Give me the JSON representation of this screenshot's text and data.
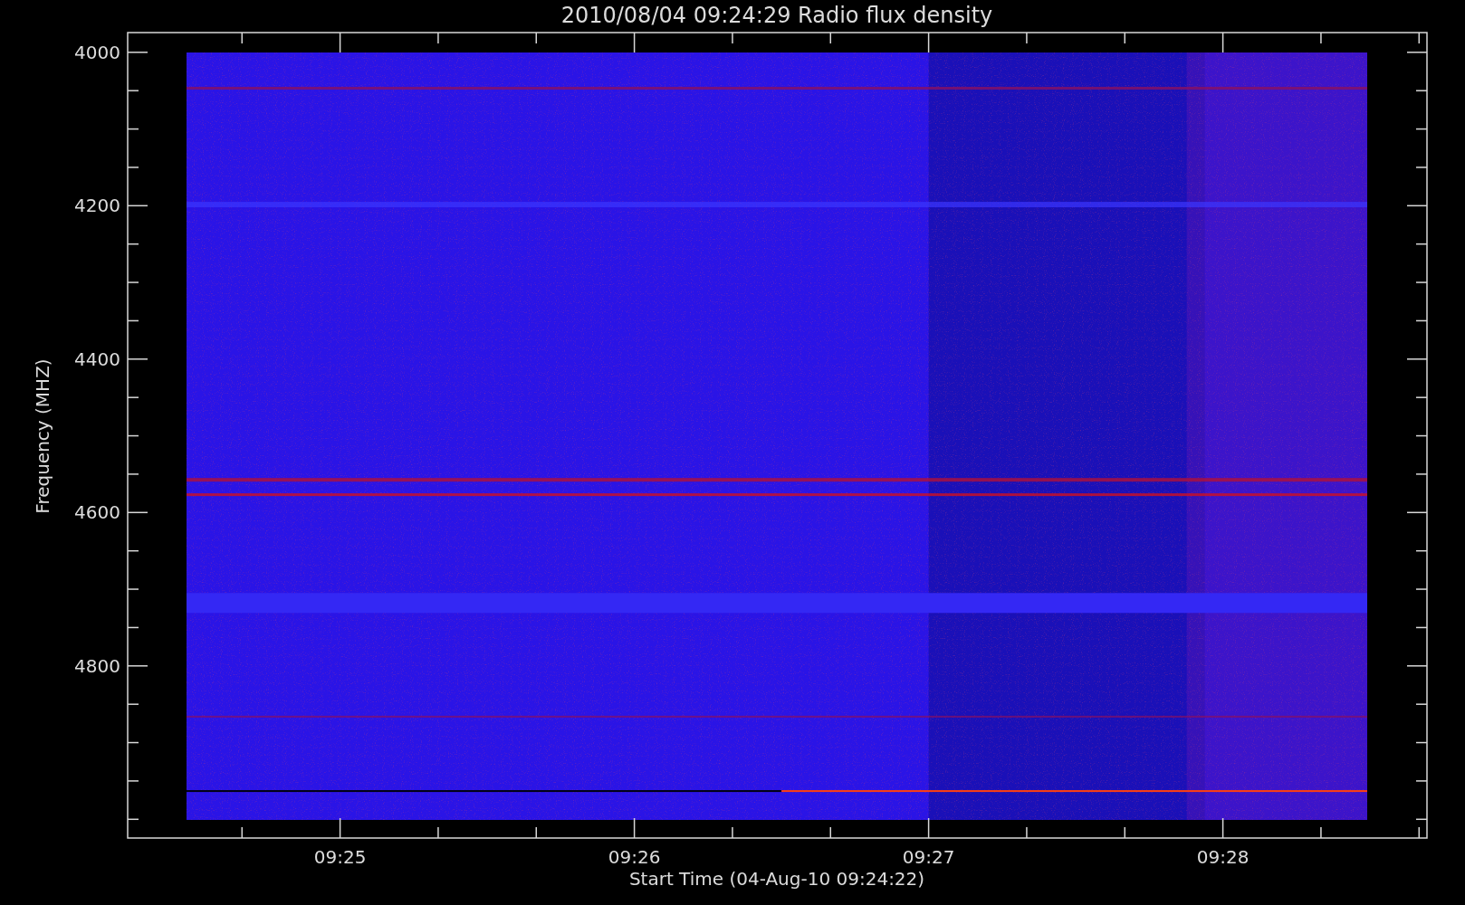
{
  "plot": {
    "title": "2010/08/04 09:24:29 Radio flux density",
    "ylabel": "Frequency (MHZ)",
    "xlabel": "Start Time (04-Aug-10 09:24:22)",
    "yticks": [
      "4000",
      "4200",
      "4400",
      "4600",
      "4800"
    ],
    "xticks": [
      "09:25",
      "09:26",
      "09:27",
      "09:28"
    ]
  }
}
